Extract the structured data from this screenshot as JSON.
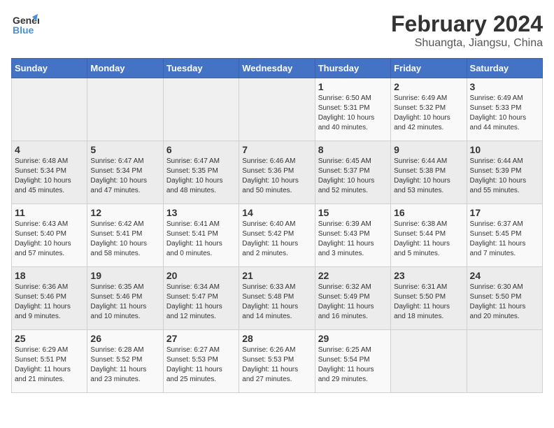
{
  "header": {
    "logo_line1": "General",
    "logo_line2": "Blue",
    "month": "February 2024",
    "location": "Shuangta, Jiangsu, China"
  },
  "weekdays": [
    "Sunday",
    "Monday",
    "Tuesday",
    "Wednesday",
    "Thursday",
    "Friday",
    "Saturday"
  ],
  "weeks": [
    [
      {
        "day": "",
        "info": ""
      },
      {
        "day": "",
        "info": ""
      },
      {
        "day": "",
        "info": ""
      },
      {
        "day": "",
        "info": ""
      },
      {
        "day": "1",
        "info": "Sunrise: 6:50 AM\nSunset: 5:31 PM\nDaylight: 10 hours\nand 40 minutes."
      },
      {
        "day": "2",
        "info": "Sunrise: 6:49 AM\nSunset: 5:32 PM\nDaylight: 10 hours\nand 42 minutes."
      },
      {
        "day": "3",
        "info": "Sunrise: 6:49 AM\nSunset: 5:33 PM\nDaylight: 10 hours\nand 44 minutes."
      }
    ],
    [
      {
        "day": "4",
        "info": "Sunrise: 6:48 AM\nSunset: 5:34 PM\nDaylight: 10 hours\nand 45 minutes."
      },
      {
        "day": "5",
        "info": "Sunrise: 6:47 AM\nSunset: 5:34 PM\nDaylight: 10 hours\nand 47 minutes."
      },
      {
        "day": "6",
        "info": "Sunrise: 6:47 AM\nSunset: 5:35 PM\nDaylight: 10 hours\nand 48 minutes."
      },
      {
        "day": "7",
        "info": "Sunrise: 6:46 AM\nSunset: 5:36 PM\nDaylight: 10 hours\nand 50 minutes."
      },
      {
        "day": "8",
        "info": "Sunrise: 6:45 AM\nSunset: 5:37 PM\nDaylight: 10 hours\nand 52 minutes."
      },
      {
        "day": "9",
        "info": "Sunrise: 6:44 AM\nSunset: 5:38 PM\nDaylight: 10 hours\nand 53 minutes."
      },
      {
        "day": "10",
        "info": "Sunrise: 6:44 AM\nSunset: 5:39 PM\nDaylight: 10 hours\nand 55 minutes."
      }
    ],
    [
      {
        "day": "11",
        "info": "Sunrise: 6:43 AM\nSunset: 5:40 PM\nDaylight: 10 hours\nand 57 minutes."
      },
      {
        "day": "12",
        "info": "Sunrise: 6:42 AM\nSunset: 5:41 PM\nDaylight: 10 hours\nand 58 minutes."
      },
      {
        "day": "13",
        "info": "Sunrise: 6:41 AM\nSunset: 5:41 PM\nDaylight: 11 hours\nand 0 minutes."
      },
      {
        "day": "14",
        "info": "Sunrise: 6:40 AM\nSunset: 5:42 PM\nDaylight: 11 hours\nand 2 minutes."
      },
      {
        "day": "15",
        "info": "Sunrise: 6:39 AM\nSunset: 5:43 PM\nDaylight: 11 hours\nand 3 minutes."
      },
      {
        "day": "16",
        "info": "Sunrise: 6:38 AM\nSunset: 5:44 PM\nDaylight: 11 hours\nand 5 minutes."
      },
      {
        "day": "17",
        "info": "Sunrise: 6:37 AM\nSunset: 5:45 PM\nDaylight: 11 hours\nand 7 minutes."
      }
    ],
    [
      {
        "day": "18",
        "info": "Sunrise: 6:36 AM\nSunset: 5:46 PM\nDaylight: 11 hours\nand 9 minutes."
      },
      {
        "day": "19",
        "info": "Sunrise: 6:35 AM\nSunset: 5:46 PM\nDaylight: 11 hours\nand 10 minutes."
      },
      {
        "day": "20",
        "info": "Sunrise: 6:34 AM\nSunset: 5:47 PM\nDaylight: 11 hours\nand 12 minutes."
      },
      {
        "day": "21",
        "info": "Sunrise: 6:33 AM\nSunset: 5:48 PM\nDaylight: 11 hours\nand 14 minutes."
      },
      {
        "day": "22",
        "info": "Sunrise: 6:32 AM\nSunset: 5:49 PM\nDaylight: 11 hours\nand 16 minutes."
      },
      {
        "day": "23",
        "info": "Sunrise: 6:31 AM\nSunset: 5:50 PM\nDaylight: 11 hours\nand 18 minutes."
      },
      {
        "day": "24",
        "info": "Sunrise: 6:30 AM\nSunset: 5:50 PM\nDaylight: 11 hours\nand 20 minutes."
      }
    ],
    [
      {
        "day": "25",
        "info": "Sunrise: 6:29 AM\nSunset: 5:51 PM\nDaylight: 11 hours\nand 21 minutes."
      },
      {
        "day": "26",
        "info": "Sunrise: 6:28 AM\nSunset: 5:52 PM\nDaylight: 11 hours\nand 23 minutes."
      },
      {
        "day": "27",
        "info": "Sunrise: 6:27 AM\nSunset: 5:53 PM\nDaylight: 11 hours\nand 25 minutes."
      },
      {
        "day": "28",
        "info": "Sunrise: 6:26 AM\nSunset: 5:53 PM\nDaylight: 11 hours\nand 27 minutes."
      },
      {
        "day": "29",
        "info": "Sunrise: 6:25 AM\nSunset: 5:54 PM\nDaylight: 11 hours\nand 29 minutes."
      },
      {
        "day": "",
        "info": ""
      },
      {
        "day": "",
        "info": ""
      }
    ]
  ]
}
